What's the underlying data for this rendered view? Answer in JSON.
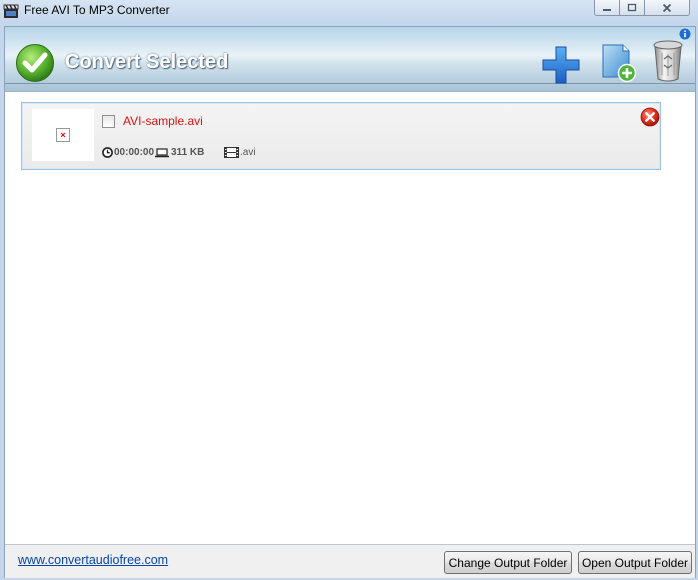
{
  "window": {
    "title": "Free AVI To MP3 Converter",
    "icon": "film-clapper-icon"
  },
  "toolbar": {
    "convert_label": "Convert Selected",
    "convert_icon": "green-check-icon",
    "add_icon": "plus-icon",
    "add_folder_icon": "add-folder-icon",
    "trash_icon": "recycle-bin-icon",
    "info_icon": "info-icon"
  },
  "files": [
    {
      "name": "AVI-sample.avi",
      "duration": "00:00:00",
      "size": "311 KB",
      "extension": ".avi",
      "checked": false
    }
  ],
  "footer": {
    "link": "www.convertaudiofree.com",
    "change_output_label": "Change Output Folder",
    "open_output_label": "Open Output Folder"
  },
  "colors": {
    "filename": "#e01010",
    "link": "#0645ad",
    "accent_blue": "#1e6fd0",
    "check_green": "#4caf2a"
  }
}
